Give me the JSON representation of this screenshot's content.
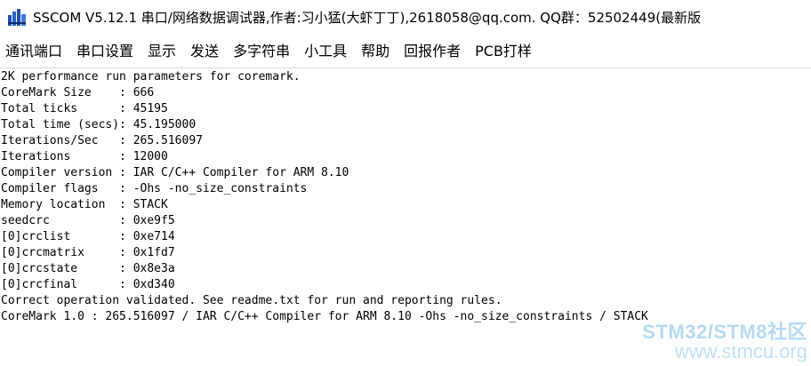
{
  "window": {
    "title": "SSCOM V5.12.1 串口/网络数据调试器,作者:习小猛(大虾丁丁),2618058@qq.com. QQ群：52502449(最新版"
  },
  "menu": {
    "items": [
      {
        "label": "通讯端口"
      },
      {
        "label": "串口设置"
      },
      {
        "label": "显示"
      },
      {
        "label": "发送"
      },
      {
        "label": "多字符串"
      },
      {
        "label": "小工具"
      },
      {
        "label": "帮助"
      },
      {
        "label": "回报作者"
      },
      {
        "label": "PCB打样"
      }
    ]
  },
  "terminal": {
    "lines": [
      "2K performance run parameters for coremark.",
      "CoreMark Size    : 666",
      "Total ticks      : 45195",
      "Total time (secs): 45.195000",
      "Iterations/Sec   : 265.516097",
      "Iterations       : 12000",
      "Compiler version : IAR C/C++ Compiler for ARM 8.10",
      "Compiler flags   : -Ohs -no_size_constraints",
      "Memory location  : STACK",
      "seedcrc          : 0xe9f5",
      "[0]crclist       : 0xe714",
      "[0]crcmatrix     : 0x1fd7",
      "[0]crcstate      : 0x8e3a",
      "[0]crcfinal      : 0xd340",
      "Correct operation validated. See readme.txt for run and reporting rules.",
      "CoreMark 1.0 : 265.516097 / IAR C/C++ Compiler for ARM 8.10 -Ohs -no_size_constraints / STACK"
    ]
  },
  "watermark": {
    "top": "STM32/STM8社区",
    "bottom": "www.stmcu.org"
  },
  "icons": {
    "app": "sscom-app-icon"
  }
}
